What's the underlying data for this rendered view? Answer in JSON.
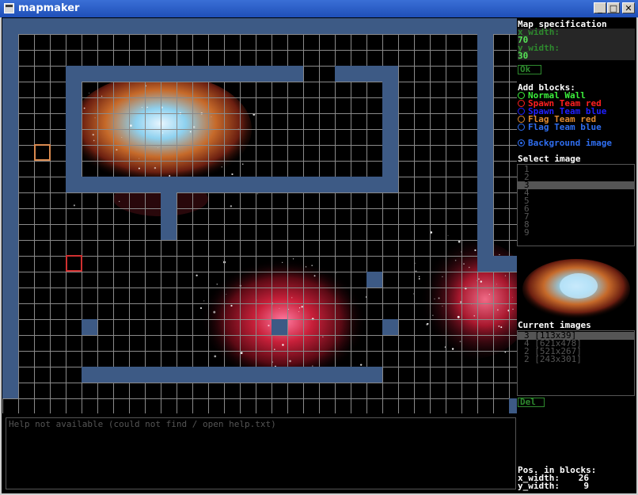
{
  "window": {
    "title": "mapmaker",
    "minimize_glyph": "_",
    "maximize_glyph": "□",
    "close_glyph": "✕"
  },
  "help": {
    "text": "Help not available (could not find / open help.txt)"
  },
  "spec": {
    "heading": "Map specification",
    "x_label": "x_width:",
    "x_value": "70",
    "y_label": "y_width:",
    "y_value": "30",
    "ok_label": "Ok"
  },
  "blocks": {
    "heading": "Add blocks:",
    "items": [
      {
        "label": "Normal Wall",
        "color": "#3cf03c"
      },
      {
        "label": "Spawn Team red",
        "color": "#ff2020"
      },
      {
        "label": "Spawn Team blue",
        "color": "#2020ff"
      },
      {
        "label": "Flag Team red",
        "color": "#e08a30"
      },
      {
        "label": "Flag Team blue",
        "color": "#2f6ef0"
      }
    ],
    "background_label": "Background image",
    "background_color": "#2f6ef0"
  },
  "select_image": {
    "heading": "Select image",
    "items": [
      "1",
      "2",
      "3",
      "4",
      "5",
      "6",
      "7",
      "8",
      "9"
    ],
    "selected": "3"
  },
  "current_images": {
    "heading": "Current images",
    "items": [
      "3 [113x39]",
      "4 [621x478]",
      "2 [521x267]",
      "2 [243x301]"
    ],
    "selected": "3 [113x39]"
  },
  "del_label": "Del",
  "position": {
    "heading": "Pos. in blocks:",
    "x_label": "x_width:",
    "x_value": "26",
    "y_label": "y_width:",
    "y_value": "9"
  },
  "colors": {
    "wall": "#3d5a85",
    "grid": "#8a8a8a",
    "panel_green": "#2e8a2e",
    "flag_marker": "#d98a50",
    "spawn_marker": "#d03030"
  }
}
